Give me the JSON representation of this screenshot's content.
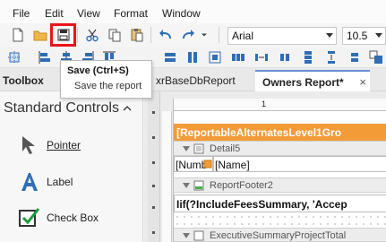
{
  "menu": [
    "File",
    "Edit",
    "View",
    "Format",
    "Window"
  ],
  "toolbar": {
    "font_name": "Arial",
    "font_size": "10.5",
    "highlight_color": "#e8141b"
  },
  "tooltip": {
    "title": "Save (Ctrl+S)",
    "description": "Save the report"
  },
  "tabs": {
    "toolbox_header": "Toolbox",
    "tab1": "xrBaseDbReport",
    "tab2": "Owners Report*",
    "close": "×"
  },
  "toolbox": {
    "section_title": "Standard Controls",
    "items": [
      {
        "label": "Pointer",
        "icon": "pointer-icon"
      },
      {
        "label": "Label",
        "icon": "label-icon"
      },
      {
        "label": "Check Box",
        "icon": "checkbox-icon"
      }
    ]
  },
  "designer": {
    "ruler_mark": "1",
    "group_band": "[ReportableAlternatesLevel1Gro",
    "detail_band": "Detail5",
    "cells": [
      "[Numb",
      "[Name]"
    ],
    "footer_band": "ReportFooter2",
    "expression": "Iif(?IncludeFeesSummary, 'Accep",
    "summary_band": "ExecutiveSummaryProjectTotal",
    "band_color": "#f39b36"
  }
}
